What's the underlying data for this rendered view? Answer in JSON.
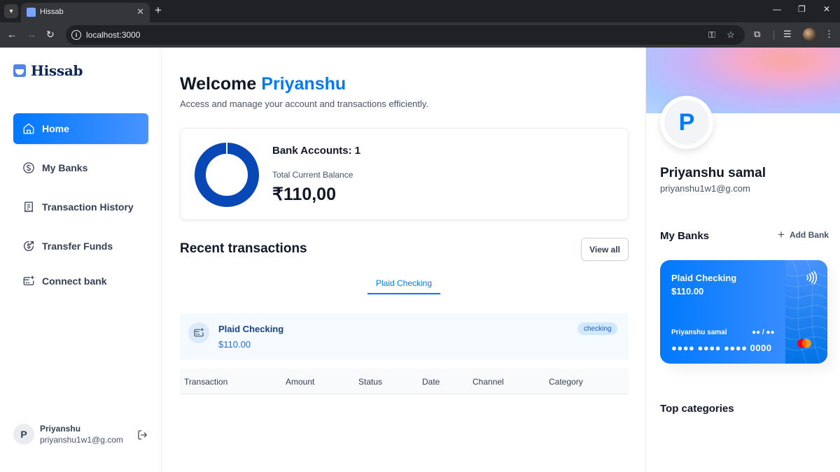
{
  "browser": {
    "tab_title": "Hissab",
    "tab_menu_icon": "chevron-down-icon",
    "new_tab_label": "+",
    "close_glyph": "✕",
    "url": "localhost:3000"
  },
  "brand": {
    "name": "Hissab",
    "color": "#0c2457"
  },
  "sidebar": {
    "items": [
      {
        "label": "Home",
        "icon": "home-icon",
        "active": true
      },
      {
        "label": "My Banks",
        "icon": "dollar-circle-icon",
        "active": false
      },
      {
        "label": "Transaction History",
        "icon": "receipt-icon",
        "active": false
      },
      {
        "label": "Transfer Funds",
        "icon": "money-send-icon",
        "active": false
      },
      {
        "label": "Connect bank",
        "icon": "card-add-icon",
        "active": false
      }
    ],
    "user": {
      "initial": "P",
      "name": "Priyanshu",
      "email": "priyanshu1w1@g.com"
    }
  },
  "header": {
    "greeting": "Welcome",
    "user_first_name": "Priyanshu",
    "subtitle": "Access and manage your account and transactions efficiently."
  },
  "balance": {
    "bank_accounts_label": "Bank Accounts: 1",
    "total_label": "Total Current Balance",
    "total_value": "₹110,00",
    "donut_color": "#0747b6"
  },
  "recent": {
    "title": "Recent transactions",
    "view_all": "View all",
    "tabs": [
      "Plaid Checking"
    ],
    "bank": {
      "name": "Plaid Checking",
      "amount": "$110.00",
      "type_badge": "checking"
    },
    "columns": [
      "Transaction",
      "Amount",
      "Status",
      "Date",
      "Channel",
      "Category"
    ]
  },
  "profile": {
    "initial": "P",
    "name": "Priyanshu samal",
    "email": "priyanshu1w1@g.com"
  },
  "my_banks": {
    "title": "My Banks",
    "add_label": "Add Bank",
    "card": {
      "bank_name": "Plaid Checking",
      "balance": "$110.00",
      "holder": "Priyanshu samal",
      "expiry": "●● / ●●",
      "number": "●●●● ●●●● ●●●● 0000"
    }
  },
  "top_categories": {
    "title": "Top categories"
  },
  "colors": {
    "accent": "#0179fe",
    "text": "#101828",
    "muted": "#475467"
  }
}
